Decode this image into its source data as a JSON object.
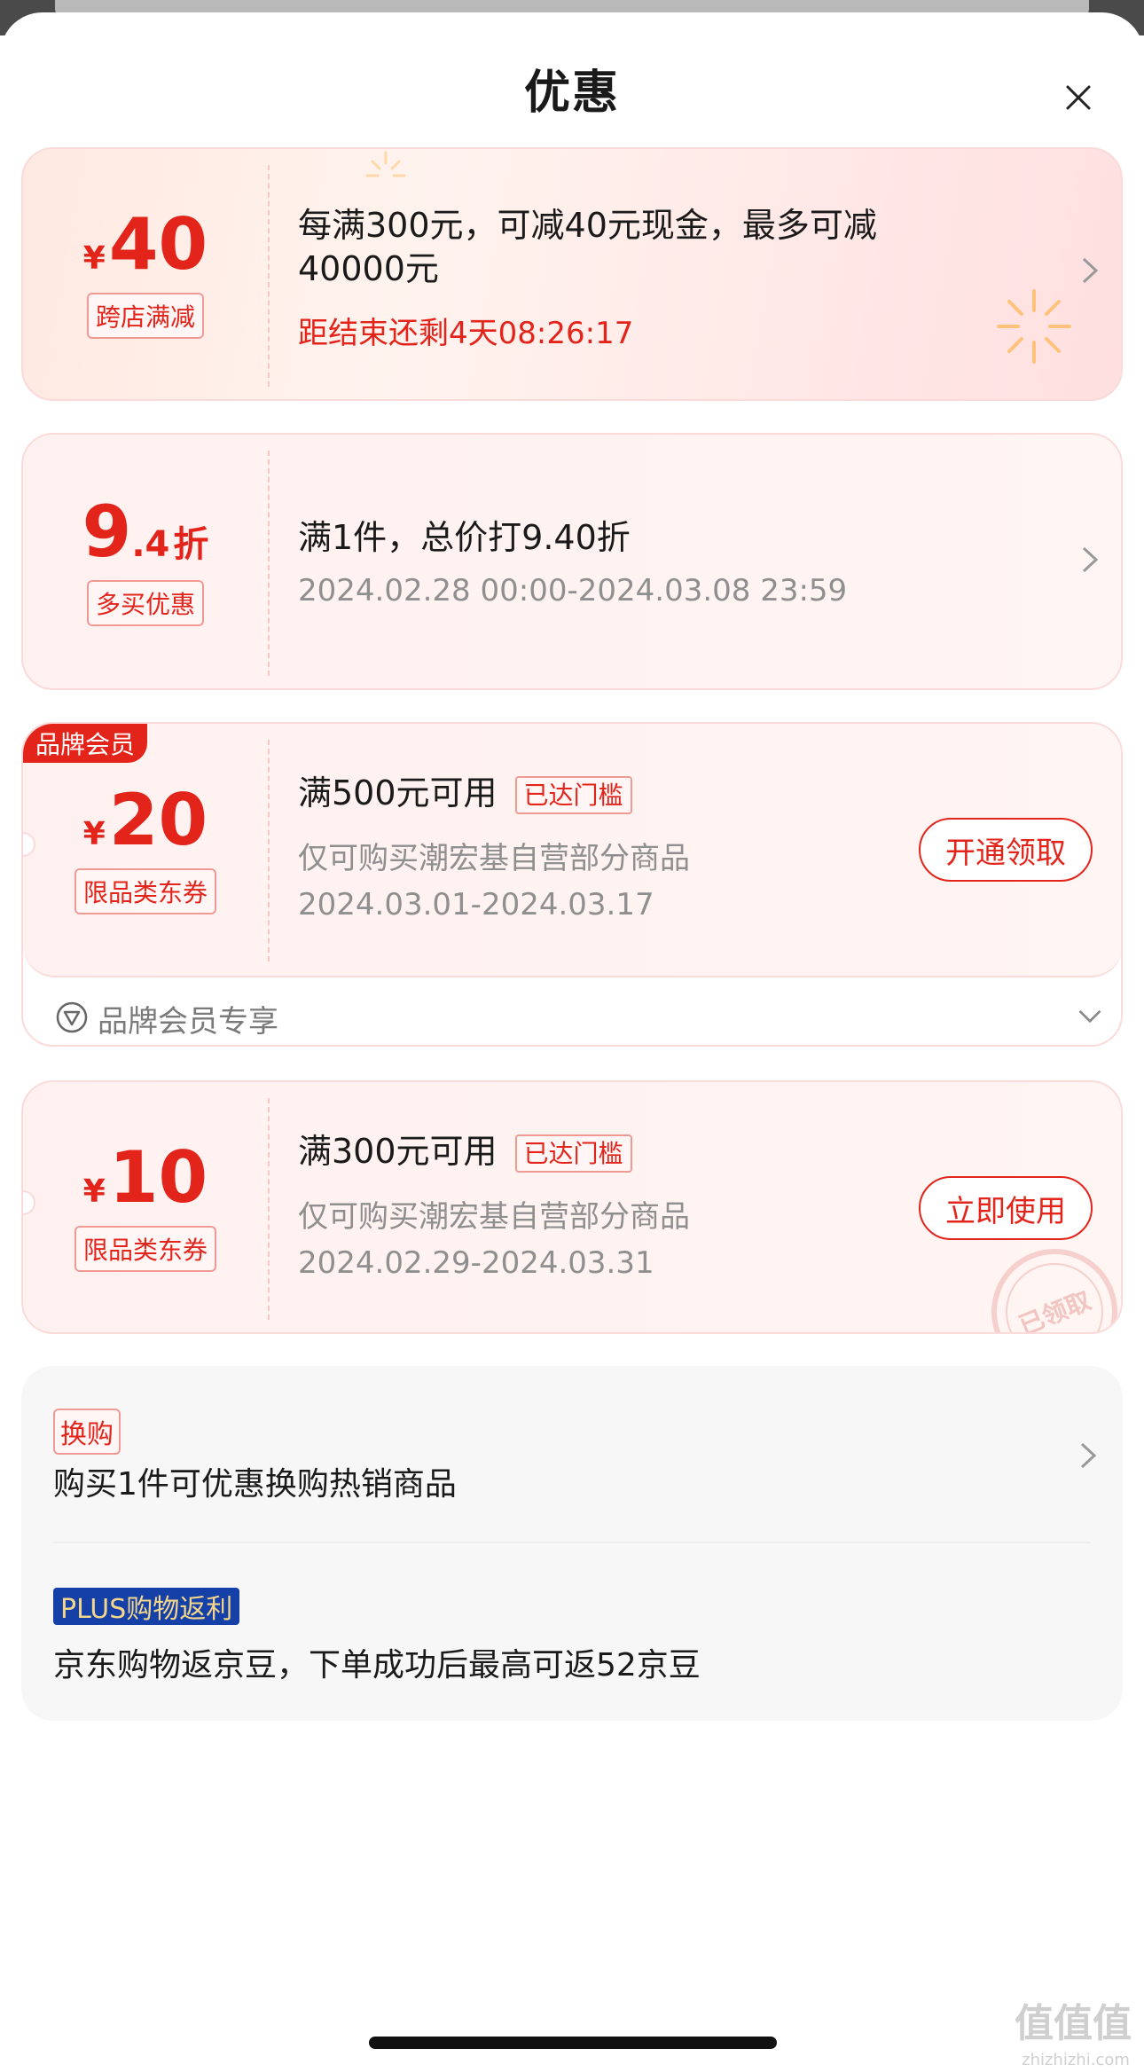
{
  "header": {
    "title": "优惠"
  },
  "cards": [
    {
      "currency": "¥",
      "amount": "40",
      "tag": "跨店满减",
      "main": "每满300元，可减40元现金，最多可减",
      "main2": "40000元",
      "countdown": "距结束还剩4天08:26:17"
    },
    {
      "amount_int": "9",
      "amount_dec": ".4",
      "unit": "折",
      "tag": "多买优惠",
      "main": "满1件，总价打9.40折",
      "date": "2024.02.28 00:00-2024.03.08 23:59"
    },
    {
      "badge": "品牌会员",
      "currency": "¥",
      "amount": "20",
      "tag": "限品类东券",
      "main": "满500元可用",
      "status": "已达门槛",
      "scope": "仅可购买潮宏基自营部分商品",
      "date": "2024.03.01-2024.03.17",
      "button": "开通领取",
      "member_label": "品牌会员专享"
    },
    {
      "currency": "¥",
      "amount": "10",
      "tag": "限品类东券",
      "main": "满300元可用",
      "status": "已达门槛",
      "scope": "仅可购买潮宏基自营部分商品",
      "date": "2024.02.29-2024.03.31",
      "button": "立即使用",
      "stamp": "已领取"
    }
  ],
  "extras": {
    "swap_tag": "换购",
    "swap_text": "购买1件可优惠换购热销商品",
    "plus_tag": "PLUS购物返利",
    "plus_text": "京东购物返京豆，下单成功后最高可返52京豆"
  },
  "watermark": {
    "text": "值值值",
    "sub": "zhizhizhi.com"
  },
  "colors": {
    "accent": "#e3241b",
    "card_bg": "#fff3f1",
    "plus_bg": "#1540a8",
    "plus_fg": "#f4d68a"
  }
}
